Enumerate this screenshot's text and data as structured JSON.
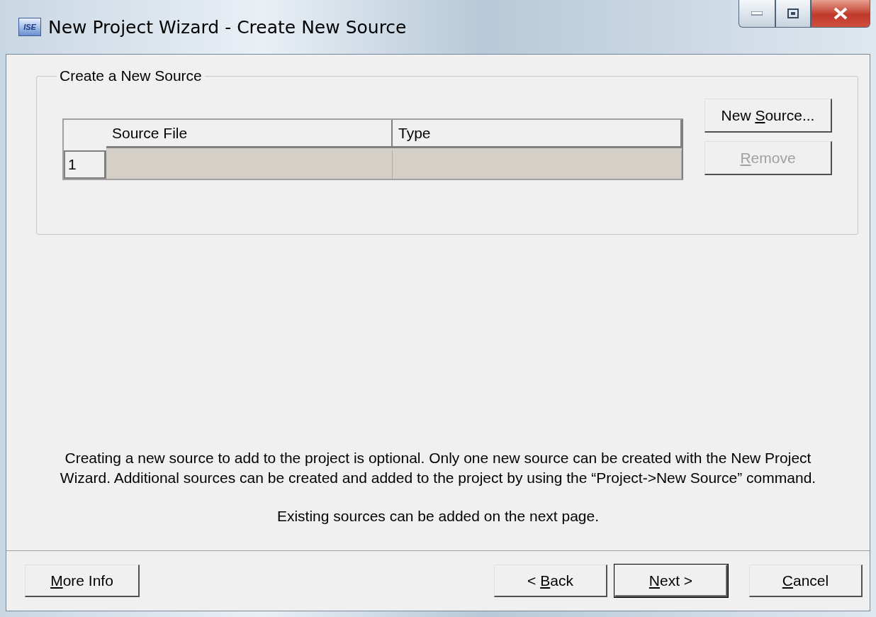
{
  "window": {
    "title": "New Project Wizard - Create New Source",
    "app_icon": "ISE"
  },
  "group": {
    "title": "Create a New Source",
    "table": {
      "columns": [
        "Source File",
        "Type"
      ],
      "rows": [
        {
          "number": "1"
        }
      ]
    },
    "buttons": [
      {
        "parts": {
          "before": "New ",
          "key": "S",
          "after": "ource..."
        },
        "disabled": false
      },
      {
        "parts": {
          "key": "R",
          "after": "emove"
        },
        "disabled": true
      }
    ]
  },
  "description": "Creating a new source to add to the project is optional. Only one new source can be created with the New Project Wizard. Additional sources can be created and added to the project by using the “Project->New Source” command.",
  "note": "Existing sources can be added on the next page.",
  "footer": {
    "left": [
      {
        "parts": {
          "key": "M",
          "after": "ore Info"
        },
        "default": false
      }
    ],
    "right": [
      {
        "parts": {
          "before": "< ",
          "key": "B",
          "after": "ack"
        },
        "default": false
      },
      {
        "parts": {
          "key": "N",
          "after": "ext >"
        },
        "default": true
      },
      {
        "parts": {
          "key": "C",
          "after": "ancel"
        },
        "default": false
      }
    ]
  }
}
